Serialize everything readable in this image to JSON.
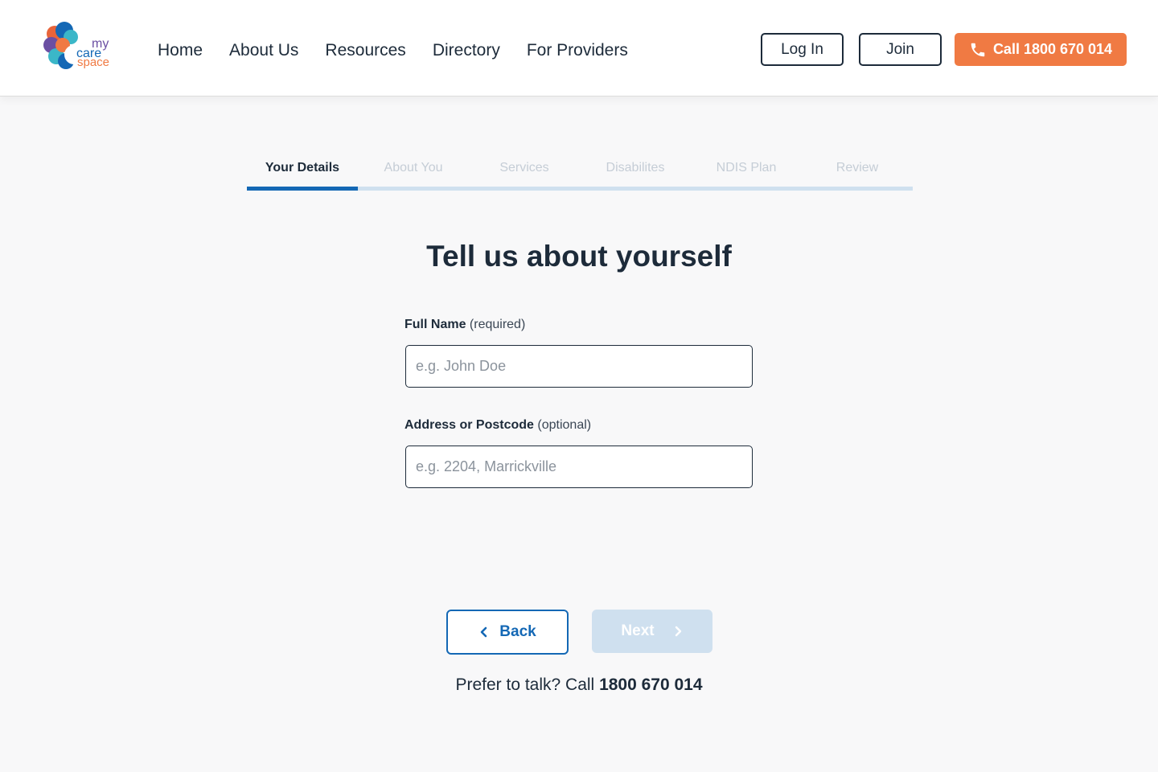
{
  "colors": {
    "brand_navy": "#1d2b3a",
    "brand_blue": "#1468b5",
    "accent_orange": "#f07a43",
    "step_inactive": "#c5cdd6",
    "track": "#cfe0ef"
  },
  "logo": {
    "line1": "my",
    "line2": "care",
    "line3": "space"
  },
  "nav": {
    "items": [
      "Home",
      "About Us",
      "Resources",
      "Directory",
      "For Providers"
    ]
  },
  "header_actions": {
    "login_label": "Log In",
    "join_label": "Join",
    "call_label": "Call 1800 670 014",
    "call_icon": "phone-icon"
  },
  "stepper": {
    "steps": [
      "Your Details",
      "About You",
      "Services",
      "Disabilites",
      "NDIS Plan",
      "Review"
    ],
    "active_index": 0
  },
  "form": {
    "title": "Tell us about yourself",
    "full_name": {
      "label": "Full Name",
      "qualifier": "(required)",
      "placeholder": "e.g. John Doe",
      "value": ""
    },
    "address": {
      "label": "Address or Postcode",
      "qualifier": "(optional)",
      "placeholder": "e.g. 2204, Marrickville",
      "value": ""
    }
  },
  "actions": {
    "back_label": "Back",
    "next_label": "Next",
    "next_enabled": false
  },
  "footer": {
    "prefix": "Prefer to talk? Call",
    "phone": "1800 670 014"
  }
}
